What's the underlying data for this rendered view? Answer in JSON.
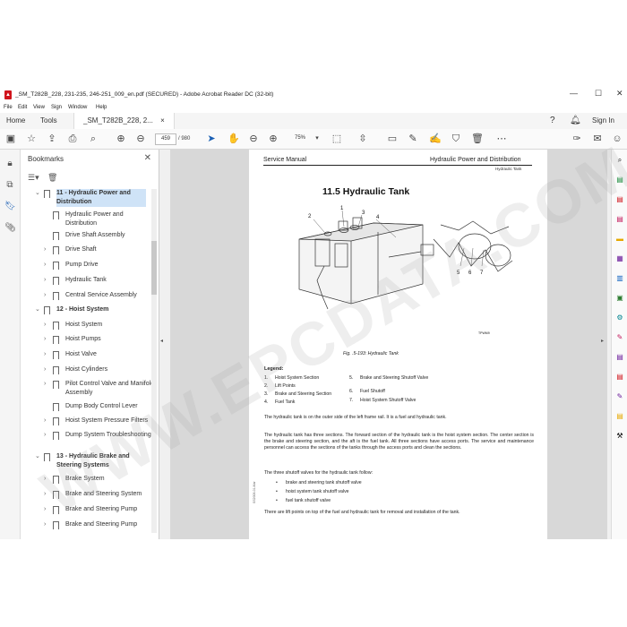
{
  "window": {
    "title": "_SM_T282B_228, 231-235, 246-251_009_en.pdf (SECURED) - Adobe Acrobat Reader DC (32-bit)",
    "minimize": "—",
    "maximize": "☐",
    "close": "✕"
  },
  "menu": [
    "File",
    "Edit",
    "View",
    "Sign",
    "Window",
    "Help"
  ],
  "tabs": {
    "home": "Home",
    "tools": "Tools",
    "document": "_SM_T282B_228, 2...",
    "document_close": "×",
    "sign_in": "Sign In"
  },
  "toolbar": {
    "page_current": "459",
    "page_total": "/ 980",
    "zoom": "75%"
  },
  "bookmarks": {
    "title": "Bookmarks",
    "items": [
      {
        "label": "11 - Hydraulic Power and Distribution",
        "level": 0,
        "expanded": true
      },
      {
        "label": "Hydraulic Power and Distribution",
        "level": 1
      },
      {
        "label": "Drive Shaft Assembly",
        "level": 1
      },
      {
        "label": "Drive Shaft",
        "level": 1,
        "collapsed": true
      },
      {
        "label": "Pump Drive",
        "level": 1,
        "collapsed": true
      },
      {
        "label": "Hydraulic Tank",
        "level": 1,
        "collapsed": true
      },
      {
        "label": "Central Service Assembly",
        "level": 1,
        "collapsed": true
      },
      {
        "label": "12 - Hoist System",
        "level": 0,
        "expanded": true
      },
      {
        "label": "Hoist System",
        "level": 1,
        "collapsed": true
      },
      {
        "label": "Hoist Pumps",
        "level": 1,
        "collapsed": true
      },
      {
        "label": "Hoist Valve",
        "level": 1,
        "collapsed": true
      },
      {
        "label": "Hoist Cylinders",
        "level": 1,
        "collapsed": true
      },
      {
        "label": "Pilot Control Valve and Manifold Assembly",
        "level": 1,
        "collapsed": true
      },
      {
        "label": "Dump Body Control Lever",
        "level": 1
      },
      {
        "label": "Hoist System Pressure Filters",
        "level": 1,
        "collapsed": true
      },
      {
        "label": "Dump System Troubleshooting",
        "level": 1,
        "collapsed": true
      },
      {
        "label": "13 - Hydraulic Brake and Steering Systems",
        "level": 0,
        "expanded": true
      },
      {
        "label": "Brake System",
        "level": 1,
        "collapsed": true
      },
      {
        "label": "Brake and Steering System",
        "level": 1,
        "collapsed": true
      },
      {
        "label": "Brake and Steering Pump",
        "level": 1,
        "collapsed": true
      },
      {
        "label": "Brake and Steering Pump",
        "level": 1,
        "collapsed": true
      }
    ]
  },
  "page": {
    "header_left": "Service Manual",
    "header_right": "Hydraulic Power and Distribution",
    "header_sub": "Hydraulic Tank",
    "section_title": "11.5  Hydraulic Tank",
    "figure_callouts": [
      "1",
      "2",
      "3",
      "4",
      "5",
      "6",
      "7"
    ],
    "figure_code": "TPWM9",
    "figure_caption": "Fig. .5-193: Hydraulic Tank",
    "legend_title": "Legend:",
    "legend": [
      {
        "num": "1.",
        "text": "Hoist System Section"
      },
      {
        "num": "2.",
        "text": "Lift Points"
      },
      {
        "num": "3.",
        "text": "Brake and Steering Section"
      },
      {
        "num": "4.",
        "text": "Fuel Tank"
      },
      {
        "num": "5.",
        "text": "Brake and Steering Shutoff Valve"
      },
      {
        "num": "6.",
        "text": "Fuel Shutoff"
      },
      {
        "num": "7.",
        "text": "Hoist System Shutoff Valve"
      }
    ],
    "para1": "The hydraulic tank is on the outer side of the left frame rail. It is a fuel and hydraulic tank.",
    "para2": "The hydraulic tank has three sections. The forward section of the hydraulic tank is the hoist system section. The center section is the brake and steering section, and the aft is the fuel tank. All three sections have access ports. The service and maintenance personnel can access the sections of the tanks through the access ports and clean the sections.",
    "para3": "The three shutoff valves for the hydraulic tank follow:",
    "bullets": [
      "brake and steering tank shutoff valve",
      "hoist system tank shutoff valve",
      "fuel tank shutoff valve"
    ],
    "para4": "There are lift points on top of the fuel and hydraulic tank for removal and installation of the tank.",
    "side_code": "SS2008-01-Mar"
  },
  "watermark": "WWW.EPCDATA.COM"
}
